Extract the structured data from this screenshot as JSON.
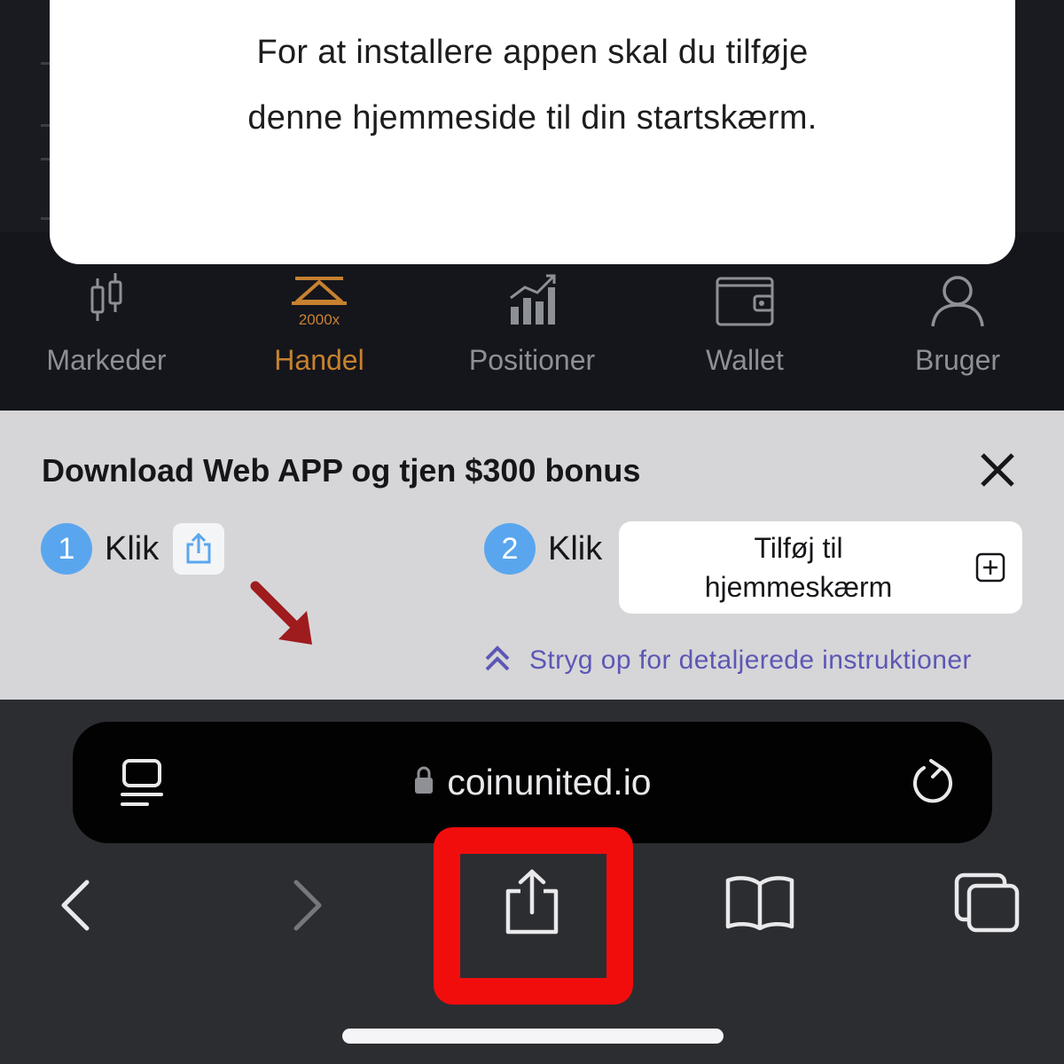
{
  "modal": {
    "line1": "For at installere appen skal du tilføje",
    "line2": "denne hjemmeside til din startskærm."
  },
  "tabbar": {
    "tabs": [
      {
        "label": "Markeder",
        "icon": "candlestick-icon"
      },
      {
        "label": "Handel",
        "icon": "trade-scale-icon",
        "badge": "2000x",
        "active": true
      },
      {
        "label": "Positioner",
        "icon": "bar-chart-icon"
      },
      {
        "label": "Wallet",
        "icon": "wallet-icon"
      },
      {
        "label": "Bruger",
        "icon": "user-icon"
      }
    ]
  },
  "banner": {
    "title": "Download Web APP og tjen $300 bonus",
    "step1": {
      "number": "1",
      "label": "Klik"
    },
    "step2": {
      "number": "2",
      "label": "Klik"
    },
    "add_button_line1": "Tilføj til",
    "add_button_line2": "hjemmeskærm",
    "hint": "Stryg op for detaljerede instruktioner"
  },
  "browser": {
    "url": "coinunited.io"
  },
  "colors": {
    "accent_active_tab": "#c7812f",
    "step_badge": "#5aa6ee",
    "hint_text": "#5d57b5",
    "highlight": "#f20d0d"
  }
}
